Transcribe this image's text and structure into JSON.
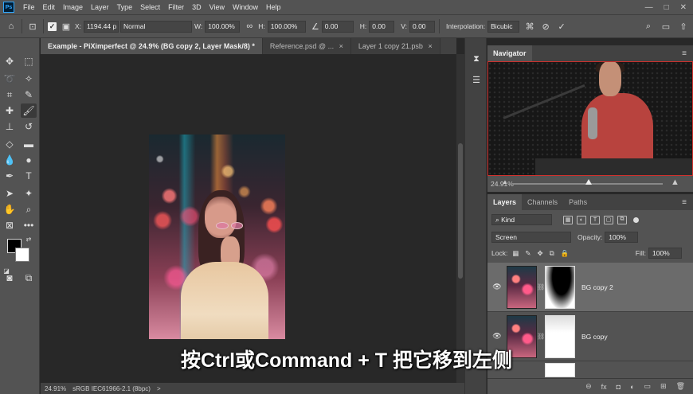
{
  "menu": {
    "logo": "Ps",
    "items": [
      "File",
      "Edit",
      "Image",
      "Layer",
      "Type",
      "Select",
      "Filter",
      "3D",
      "View",
      "Window",
      "Help"
    ],
    "window_controls": [
      "—",
      "□",
      "✕"
    ]
  },
  "options": {
    "x_label": "X:",
    "x_value": "1194.44 p",
    "blend_mode": "Normal",
    "w_label": "W:",
    "w_value": "100.00%",
    "h_label": "H:",
    "h_value": "100.00%",
    "angle_value": "0.00",
    "h2_label": "H:",
    "h2_value": "0.00",
    "v_label": "V:",
    "v_value": "0.00",
    "interp_label": "Interpolation:",
    "interp_value": "Bicubic"
  },
  "tabs": [
    {
      "label": "Example - PiXimperfect @ 24.9% (BG copy 2, Layer Mask/8) *",
      "close": "×"
    },
    {
      "label": "Reference.psd @ ...",
      "close": "×"
    },
    {
      "label": "Layer 1 copy 21.psb",
      "close": "×"
    }
  ],
  "status": {
    "zoom": "24.91%",
    "profile": "sRGB IEC61966-2.1 (8bpc)",
    "arrow": ">"
  },
  "subtitle": "按Ctrl或Command + T 把它移到左侧",
  "navigator": {
    "tab": "Navigator",
    "zoom": "24.91%",
    "mountain_small": "▲",
    "mountain_large": "▲"
  },
  "layers_panel": {
    "tabs": [
      "Layers",
      "Channels",
      "Paths"
    ],
    "kind_label": "Kind",
    "blend_mode": "Screen",
    "opacity_label": "Opacity:",
    "opacity_value": "100%",
    "lock_label": "Lock:",
    "fill_label": "Fill:",
    "fill_value": "100%",
    "layers": [
      {
        "name": "BG copy 2",
        "selected": true
      },
      {
        "name": "BG copy",
        "selected": false
      }
    ],
    "footer_icons": [
      "link-icon",
      "fx-icon",
      "mask-icon",
      "adjustment-icon",
      "group-icon",
      "new-layer-icon",
      "trash-icon"
    ],
    "footer_glyphs": [
      "⊖",
      "fx",
      "◘",
      "◐",
      "▭",
      "⊞",
      "🗑"
    ]
  },
  "colors": {
    "panel": "#535353",
    "canvas": "#282828",
    "accent": "#31a8ff"
  }
}
